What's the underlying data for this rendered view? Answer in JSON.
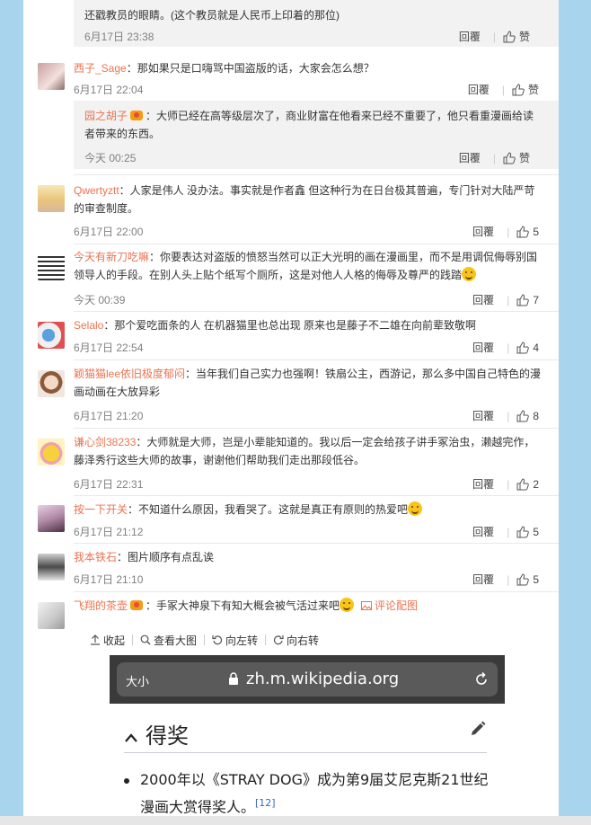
{
  "comments": [
    {
      "text": "还戳教员的眼睛。(这个教员就是人民币上印着的那位)",
      "time": "6月17日 23:38",
      "reply": "回覆",
      "like": "赞"
    },
    {
      "user": "西子_Sage",
      "text": "：那如果只是口嗨骂中国盗版的话，大家会怎么想？",
      "time": "6月17日 22:04",
      "reply": "回覆",
      "like": "赞"
    },
    {
      "user": "园之胡子",
      "text": "：大师已经在高等级层次了，商业财富在他看来已经不重要了，他只看重漫画给读者带来的东西。",
      "time": "今天 00:25",
      "reply": "回覆",
      "like": "赞"
    },
    {
      "user": "Qwertyztt",
      "text": "：人家是伟人 没办法。事实就是作者鑫 但这种行为在日台极其普遍，专门针对大陆严苛的审查制度。",
      "time": "6月17日 22:00",
      "reply": "回覆",
      "like": "5"
    },
    {
      "user": "今天有新刀吃嘛",
      "text": "：你要表达对盗版的愤怒当然可以正大光明的画在漫画里，而不是用调侃侮辱别国领导人的手段。在别人头上贴个纸写个厕所，这是对他人人格的侮辱及尊严的践踏",
      "time": "今天 00:39",
      "reply": "回覆",
      "like": "7"
    },
    {
      "user": "Selalo",
      "text": "：那个爱吃面条的人 在机器猫里也总出现 原来也是藤子不二雄在向前辈致敬啊",
      "time": "6月17日 22:54",
      "reply": "回覆",
      "like": "4"
    },
    {
      "user": "颖猫猫lee依旧极度郁闷",
      "text": "：当年我们自己实力也强啊！铁扇公主，西游记，那么多中国自己特色的漫画动画在大放异彩",
      "time": "6月17日 21:20",
      "reply": "回覆",
      "like": "8"
    },
    {
      "user": "谦心剑38233",
      "text": "：大师就是大师，岂是小辈能知道的。我以后一定会给孩子讲手冢治虫，濑越完作，藤泽秀行这些大师的故事，谢谢他们帮助我们走出那段低谷。",
      "time": "6月17日 22:31",
      "reply": "回覆",
      "like": "2"
    },
    {
      "user": "按一下开关",
      "text": "：不知道什么原因，我看哭了。这就是真正有原则的热爱吧",
      "time": "6月17日 21:12",
      "reply": "回覆",
      "like": "5"
    },
    {
      "user": "我本铁石",
      "text": "：图片顺序有点乱诶",
      "time": "6月17日 21:10",
      "reply": "回覆",
      "like": "5"
    },
    {
      "user": "飞翔的茶壶",
      "text": "：手冢大神泉下有知大概会被气活过来吧",
      "pic_link": "评论配图"
    }
  ],
  "pic_toolbar": {
    "collapse": "收起",
    "view_large": "查看大图",
    "rotate_left": "向左转",
    "rotate_right": "向右转"
  },
  "embedded": {
    "text_size": "大小",
    "url": "zh.m.wikipedia.org",
    "heading": "得奖",
    "item": "2000年以《STRAY DOG》成为第9届艾尼克斯21世纪漫画大赏得奖人。",
    "ref": "[12]"
  }
}
